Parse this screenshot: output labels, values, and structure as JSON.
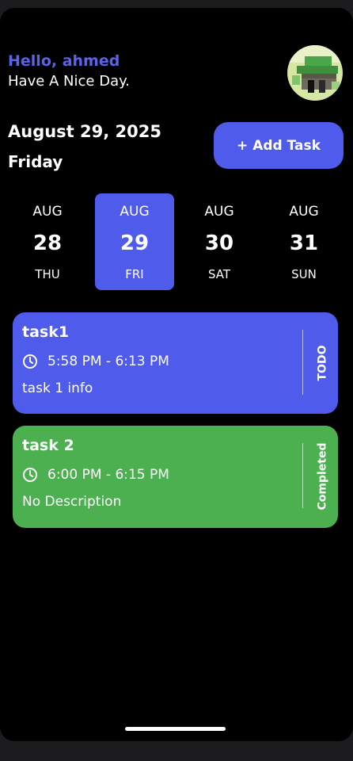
{
  "header": {
    "greeting": "Hello, ahmed",
    "subtitle": "Have A Nice Day."
  },
  "date_header": {
    "date": "August 29, 2025",
    "weekday": "Friday"
  },
  "add_task_label": "+ Add Task",
  "date_picker": [
    {
      "month": "AUG",
      "day": "28",
      "weekday": "THU",
      "selected": false
    },
    {
      "month": "AUG",
      "day": "29",
      "weekday": "FRI",
      "selected": true
    },
    {
      "month": "AUG",
      "day": "30",
      "weekday": "SAT",
      "selected": false
    },
    {
      "month": "AUG",
      "day": "31",
      "weekday": "SUN",
      "selected": false
    }
  ],
  "tasks": [
    {
      "title": "task1",
      "time": "5:58 PM - 6:13 PM",
      "description": "task 1 info",
      "status": "TODO",
      "color": "#4f5bea"
    },
    {
      "title": "task 2",
      "time": "6:00 PM - 6:15 PM",
      "description": "No Description",
      "status": "Completed",
      "color": "#4caf50"
    }
  ],
  "colors": {
    "accent": "#4f5bea",
    "greeting": "#5b63e8",
    "completed": "#4caf50",
    "background": "#000000"
  }
}
